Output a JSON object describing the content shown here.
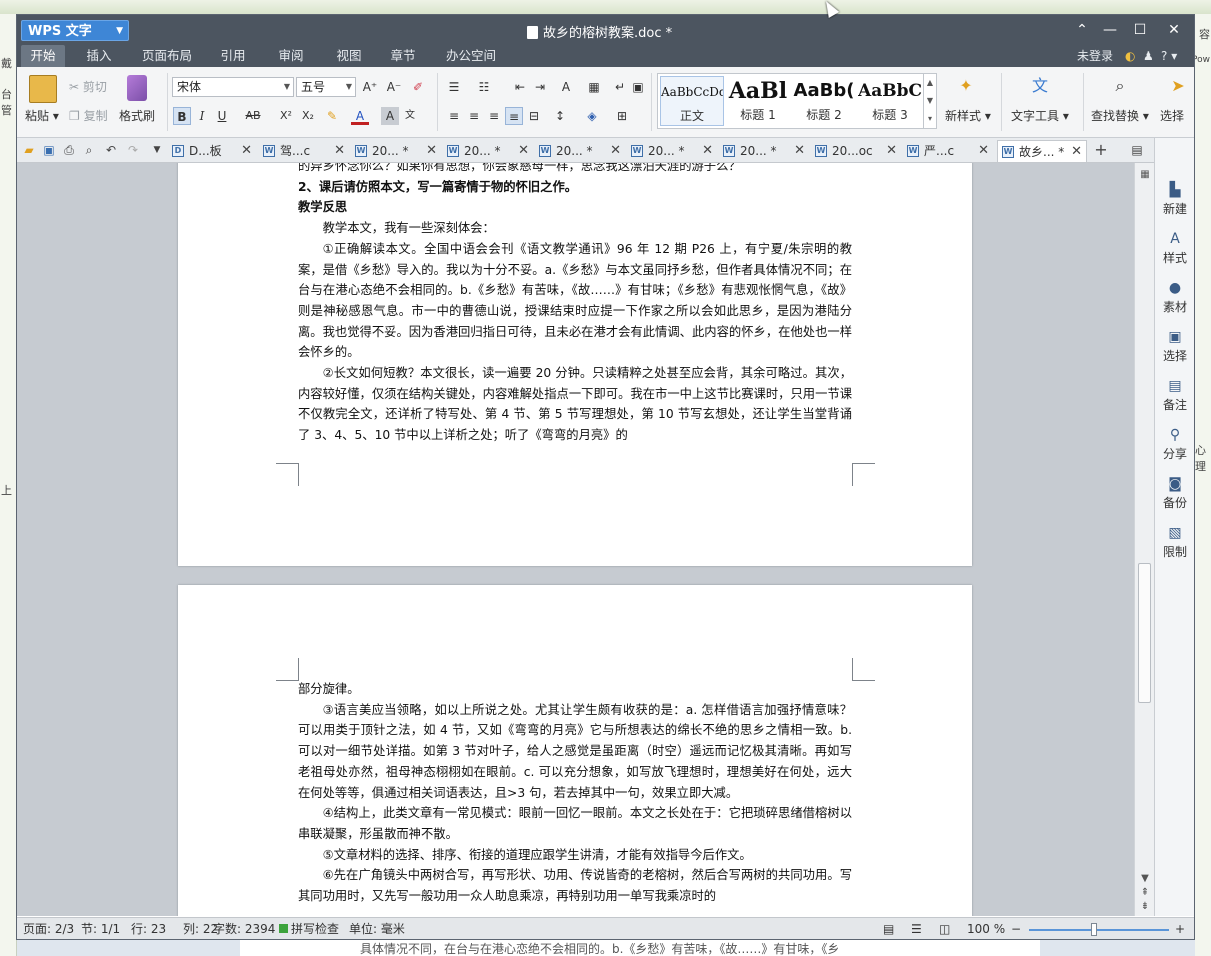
{
  "background": {
    "left_fragments": [
      "戴",
      "台管",
      "上"
    ],
    "right_fragments": [
      "容",
      "Pow",
      "心理"
    ],
    "bottom_text": "具体情况不同，在台与在港心恋绝不会相同的。b.《乡愁》有苦味，《故……》有甘味，《乡"
  },
  "titlebar": {
    "app_name": "WPS 文字",
    "doc_title": "故乡的榕树教案.doc *",
    "controls": [
      "⌃",
      "—",
      "☐",
      "✕"
    ]
  },
  "menu_tabs": [
    "开始",
    "插入",
    "页面布局",
    "引用",
    "审阅",
    "视图",
    "章节",
    "办公空间"
  ],
  "menu_right": {
    "login": "未登录",
    "help": "?"
  },
  "ribbon": {
    "paste": "粘贴",
    "cut": "剪切",
    "copy": "复制",
    "format_painter": "格式刷",
    "font_name": "宋体",
    "font_size": "五号",
    "bold": "B",
    "italic": "I",
    "underline": "U",
    "strike": "AB",
    "superscript": "X²",
    "subscript": "X₂",
    "styles": [
      {
        "preview": "AaBbCcDd",
        "label": "正文"
      },
      {
        "preview": "AaBl",
        "label": "标题 1"
      },
      {
        "preview": "AaBb(",
        "label": "标题 2"
      },
      {
        "preview": "AaBbC",
        "label": "标题 3"
      }
    ],
    "new_style": "新样式",
    "text_tools": "文字工具",
    "find_replace": "查找替换",
    "select": "选择"
  },
  "doc_tabs": [
    {
      "label": "D...板",
      "icon": "D",
      "active": false
    },
    {
      "label": "驾...c",
      "icon": "W",
      "active": false
    },
    {
      "label": "20... *",
      "icon": "W",
      "active": false
    },
    {
      "label": "20... *",
      "icon": "W",
      "active": false
    },
    {
      "label": "20... *",
      "icon": "W",
      "active": false
    },
    {
      "label": "20... *",
      "icon": "W",
      "active": false
    },
    {
      "label": "20... *",
      "icon": "W",
      "active": false
    },
    {
      "label": "20...oc",
      "icon": "W",
      "active": false
    },
    {
      "label": "严...c",
      "icon": "W",
      "active": false
    },
    {
      "label": "故乡... *",
      "icon": "W",
      "active": true
    }
  ],
  "page1_paragraphs": [
    {
      "text": "的异乡怀念你么？如果你有思想，你会象慈母一样，思念我这漂泊天涯的游子么？",
      "indent": false,
      "bold": false
    },
    {
      "text": "2、课后请仿照本文，写一篇寄情于物的怀旧之作。",
      "indent": false,
      "bold": true
    },
    {
      "text": "教学反思",
      "indent": false,
      "bold": true
    },
    {
      "text": "教学本文，我有一些深刻体会：",
      "indent": true,
      "bold": false
    },
    {
      "text": "①正确解读本文。全国中语会会刊《语文教学通讯》96 年 12 期 P26 上，有宁夏/朱宗明的教案，是借《乡愁》导入的。我以为十分不妥。a.《乡愁》与本文虽同抒乡愁，但作者具体情况不同；在台与在港心态绝不会相同的。b.《乡愁》有苦味，《故……》有甘味；《乡愁》有悲观怅惘气息，《故》则是神秘感恩气息。市一中的曹德山说，授课结束时应提一下作家之所以会如此思乡，是因为港陆分离。我也觉得不妥。因为香港回归指日可待，且未必在港才会有此情调、此内容的怀乡，在他处也一样会怀乡的。",
      "indent": true,
      "bold": false
    },
    {
      "text": "②长文如何短教？本文很长，读一遍要 20 分钟。只读精粹之处甚至应会背，其余可略过。其次，内容较好懂，仅须在结构关键处，内容难解处指点一下即可。我在市一中上这节比赛课时，只用一节课不仅教完全文，还详析了特写处、第 4 节、第 5 节写理想处，第 10 节写玄想处，还让学生当堂背诵了 3、4、5、10 节中以上详析之处；听了《弯弯的月亮》的",
      "indent": true,
      "bold": false
    }
  ],
  "page2_paragraphs": [
    {
      "text": "部分旋律。",
      "indent": false,
      "bold": false
    },
    {
      "text": "③语言美应当领略，如以上所说之处。尤其让学生颇有收获的是：a. 怎样借语言加强抒情意味？可以用类于顶针之法，如 4 节，又如《弯弯的月亮》它与所想表达的绵长不绝的思乡之情相一致。b. 可以对一细节处详描。如第 3 节对叶子，给人之感觉是虽距离（时空）遥远而记忆极其清晰。再如写老祖母处亦然，祖母神态栩栩如在眼前。c. 可以充分想象，如写放飞理想时，理想美好在何处，远大在何处等等，俱通过相关词语表达，且>3 句，若去掉其中一句，效果立即大减。",
      "indent": true,
      "bold": false
    },
    {
      "text": "④结构上，此类文章有一常见模式：眼前一回忆一眼前。本文之长处在于：它把琐碎思绪借榕树以串联凝聚，形虽散而神不散。",
      "indent": true,
      "bold": false
    },
    {
      "text": "⑤文章材料的选择、排序、衔接的道理应跟学生讲清，才能有效指导今后作文。",
      "indent": true,
      "bold": false
    },
    {
      "text": "⑥先在广角镜头中两树合写，再写形状、功用、传说皆奇的老榕树，然后合写两树的共同功用。写其同功用时，又先写一般功用一众人助息乘凉，再特别功用一单写我乘凉时的",
      "indent": true,
      "bold": false
    }
  ],
  "sidebar": [
    {
      "icon": "new-icon",
      "glyph": "▙",
      "label": "新建"
    },
    {
      "icon": "style-icon",
      "glyph": "A",
      "label": "样式"
    },
    {
      "icon": "material-icon",
      "glyph": "●",
      "label": "素材"
    },
    {
      "icon": "select-icon",
      "glyph": "▣",
      "label": "选择"
    },
    {
      "icon": "comment-icon",
      "glyph": "▤",
      "label": "备注"
    },
    {
      "icon": "share-icon",
      "glyph": "⚲",
      "label": "分享"
    },
    {
      "icon": "backup-icon",
      "glyph": "◙",
      "label": "备份"
    },
    {
      "icon": "restrict-icon",
      "glyph": "▧",
      "label": "限制"
    }
  ],
  "status": {
    "page": "页面: 2/3",
    "section": "节: 1/1",
    "line": "行: 23",
    "col": "列: 22",
    "words": "字数: 2394",
    "spell": "拼写检查",
    "unit": "单位: 毫米",
    "zoom": "100 %",
    "zoom_level": 0.5
  },
  "colors": {
    "titlebar": "#4c5560",
    "accent": "#3e86d6",
    "canvas": "#c6cbd1"
  }
}
